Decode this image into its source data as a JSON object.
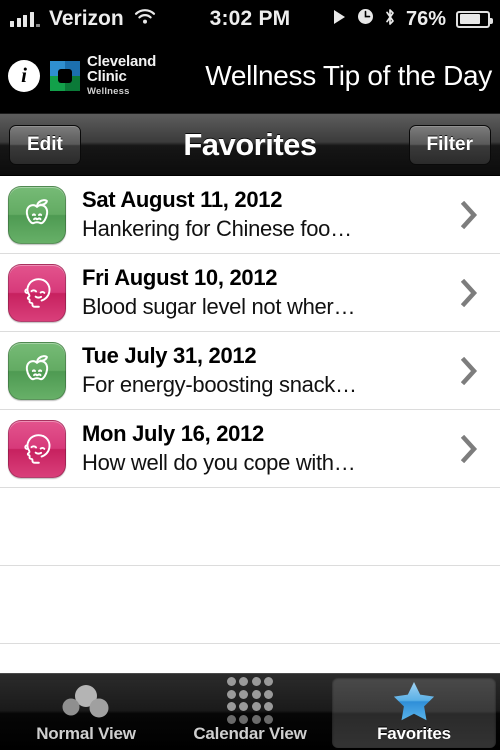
{
  "status_bar": {
    "carrier": "Verizon",
    "time": "3:02 PM",
    "battery_percent": "76%",
    "icons": [
      "signal-bars-icon",
      "wifi-icon",
      "play-icon",
      "alarm-clock-icon",
      "bluetooth-icon",
      "battery-icon"
    ]
  },
  "brand_header": {
    "info_icon_label": "i",
    "logo_name": "Cleveland Clinic",
    "logo_sub": "Wellness",
    "app_title": "Wellness Tip of the Day"
  },
  "nav_bar": {
    "edit_label": "Edit",
    "title": "Favorites",
    "filter_label": "Filter"
  },
  "list": {
    "rows": [
      {
        "icon": "apple-icon",
        "icon_color": "green",
        "date": "Sat August 11, 2012",
        "snippet": "Hankering for Chinese foo…"
      },
      {
        "icon": "head-face-icon",
        "icon_color": "pink",
        "date": "Fri August 10, 2012",
        "snippet": "Blood sugar level not wher…"
      },
      {
        "icon": "apple-icon",
        "icon_color": "green",
        "date": "Tue July 31, 2012",
        "snippet": "For energy-boosting snack…"
      },
      {
        "icon": "head-face-icon",
        "icon_color": "pink",
        "date": "Mon July 16, 2012",
        "snippet": "How well do you cope with…"
      }
    ],
    "empty_row_count": 3
  },
  "tab_bar": {
    "tabs": [
      {
        "label": "Normal View",
        "icon": "bubbles-icon",
        "active": false
      },
      {
        "label": "Calendar View",
        "icon": "dot-grid-icon",
        "active": false
      },
      {
        "label": "Favorites",
        "icon": "star-icon",
        "active": true
      }
    ]
  },
  "colors": {
    "green_icon": "#63ab63",
    "pink_icon": "#d7397a",
    "star_blue": "#4aa3e0",
    "nav_dark": "#1a1a1a"
  }
}
